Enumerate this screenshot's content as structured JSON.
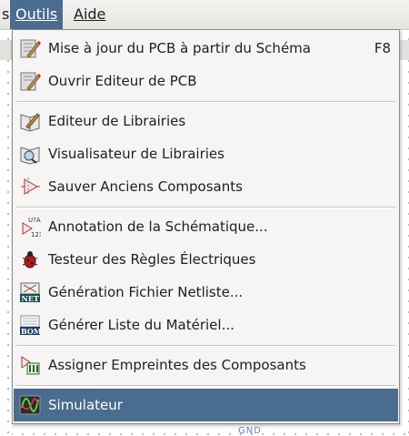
{
  "menubar": {
    "partial_left": "s",
    "items": [
      {
        "label": "Outils",
        "active": true
      },
      {
        "label": "Aide",
        "active": false
      }
    ]
  },
  "canvas": {
    "net_label": "GND"
  },
  "dropdown": {
    "items": [
      {
        "label": "Mise à jour du PCB à partir du  Schéma",
        "shortcut": "F8",
        "icon": "pcb-update-icon"
      },
      {
        "label": "Ouvrir Editeur de PCB",
        "shortcut": "",
        "icon": "pcbnew-icon"
      },
      {
        "label": "Editeur de Librairies",
        "shortcut": "",
        "icon": "library-editor-icon"
      },
      {
        "label": "Visualisateur de Librairies",
        "shortcut": "",
        "icon": "library-browser-icon"
      },
      {
        "label": "Sauver Anciens Composants",
        "shortcut": "",
        "icon": "rescue-symbols-icon"
      },
      {
        "label": "Annotation de la Schématique...",
        "shortcut": "",
        "icon": "annotate-icon"
      },
      {
        "label": "Testeur des Règles Électriques",
        "shortcut": "",
        "icon": "erc-bug-icon"
      },
      {
        "label": "Génération Fichier Netliste...",
        "shortcut": "",
        "icon": "netlist-icon"
      },
      {
        "label": "Générer Liste du Matériel...",
        "shortcut": "",
        "icon": "bom-icon"
      },
      {
        "label": "Assigner Empreintes des Composants",
        "shortcut": "",
        "icon": "cvpcb-icon"
      },
      {
        "label": "Simulateur",
        "shortcut": "",
        "icon": "simulator-icon",
        "selected": true
      }
    ]
  },
  "icons": {
    "net_text": "NET",
    "bom_text": "BOM",
    "annotate_top": "U?A",
    "annotate_bottom": "123"
  },
  "colors": {
    "accent": "#4a6c8e",
    "menu_bg": "#f6f5f4"
  }
}
